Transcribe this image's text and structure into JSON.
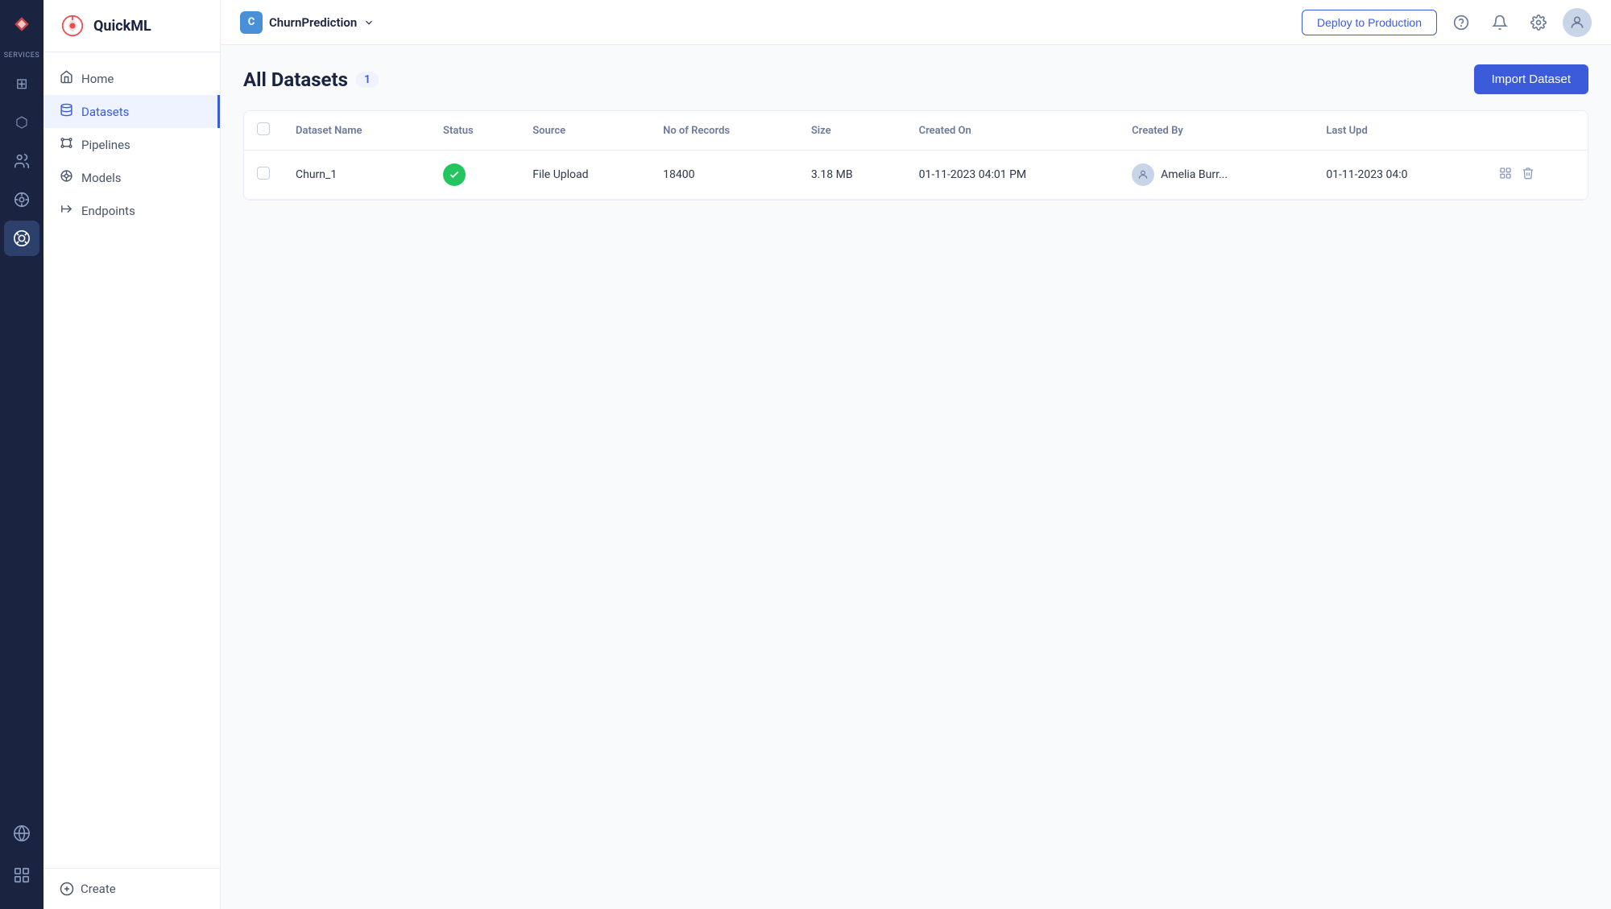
{
  "rail": {
    "services_label": "Services",
    "icons": [
      {
        "name": "grid-icon",
        "symbol": "⊞",
        "active": false
      },
      {
        "name": "chart-icon",
        "symbol": "◈",
        "active": false
      },
      {
        "name": "people-icon",
        "symbol": "⟁",
        "active": false
      },
      {
        "name": "analytics-icon",
        "symbol": "⬡",
        "active": false
      },
      {
        "name": "quickml-active-icon",
        "symbol": "◎",
        "active": true
      },
      {
        "name": "globe-icon",
        "symbol": "⊕",
        "active": false
      },
      {
        "name": "settings-icon",
        "symbol": "⊛",
        "active": false
      }
    ]
  },
  "sidebar": {
    "title": "QuickML",
    "nav_items": [
      {
        "label": "Home",
        "icon": "🏠",
        "name": "home",
        "active": false
      },
      {
        "label": "Datasets",
        "icon": "🗄",
        "name": "datasets",
        "active": true
      },
      {
        "label": "Pipelines",
        "icon": "⧫",
        "name": "pipelines",
        "active": false
      },
      {
        "label": "Models",
        "icon": "◉",
        "name": "models",
        "active": false
      },
      {
        "label": "Endpoints",
        "icon": "⚑",
        "name": "endpoints",
        "active": false
      }
    ],
    "create_label": "Create"
  },
  "topbar": {
    "project_initial": "C",
    "project_name": "ChurnPrediction",
    "deploy_label": "Deploy to Production"
  },
  "page": {
    "title": "All Datasets",
    "count": "1",
    "import_label": "Import Dataset"
  },
  "table": {
    "columns": [
      {
        "label": "",
        "name": "checkbox-col"
      },
      {
        "label": "Dataset Name",
        "name": "dataset-name-col"
      },
      {
        "label": "Status",
        "name": "status-col"
      },
      {
        "label": "Source",
        "name": "source-col"
      },
      {
        "label": "No of Records",
        "name": "records-col"
      },
      {
        "label": "Size",
        "name": "size-col"
      },
      {
        "label": "Created On",
        "name": "created-on-col"
      },
      {
        "label": "Created By",
        "name": "created-by-col"
      },
      {
        "label": "Last Upd",
        "name": "last-updated-col"
      },
      {
        "label": "",
        "name": "actions-col"
      }
    ],
    "rows": [
      {
        "name": "Churn_1",
        "status": "active",
        "source": "File Upload",
        "records": "18400",
        "size": "3.18 MB",
        "created_on": "01-11-2023 04:01 PM",
        "created_by": "Amelia Burr...",
        "last_updated": "01-11-2023 04:0"
      }
    ]
  }
}
